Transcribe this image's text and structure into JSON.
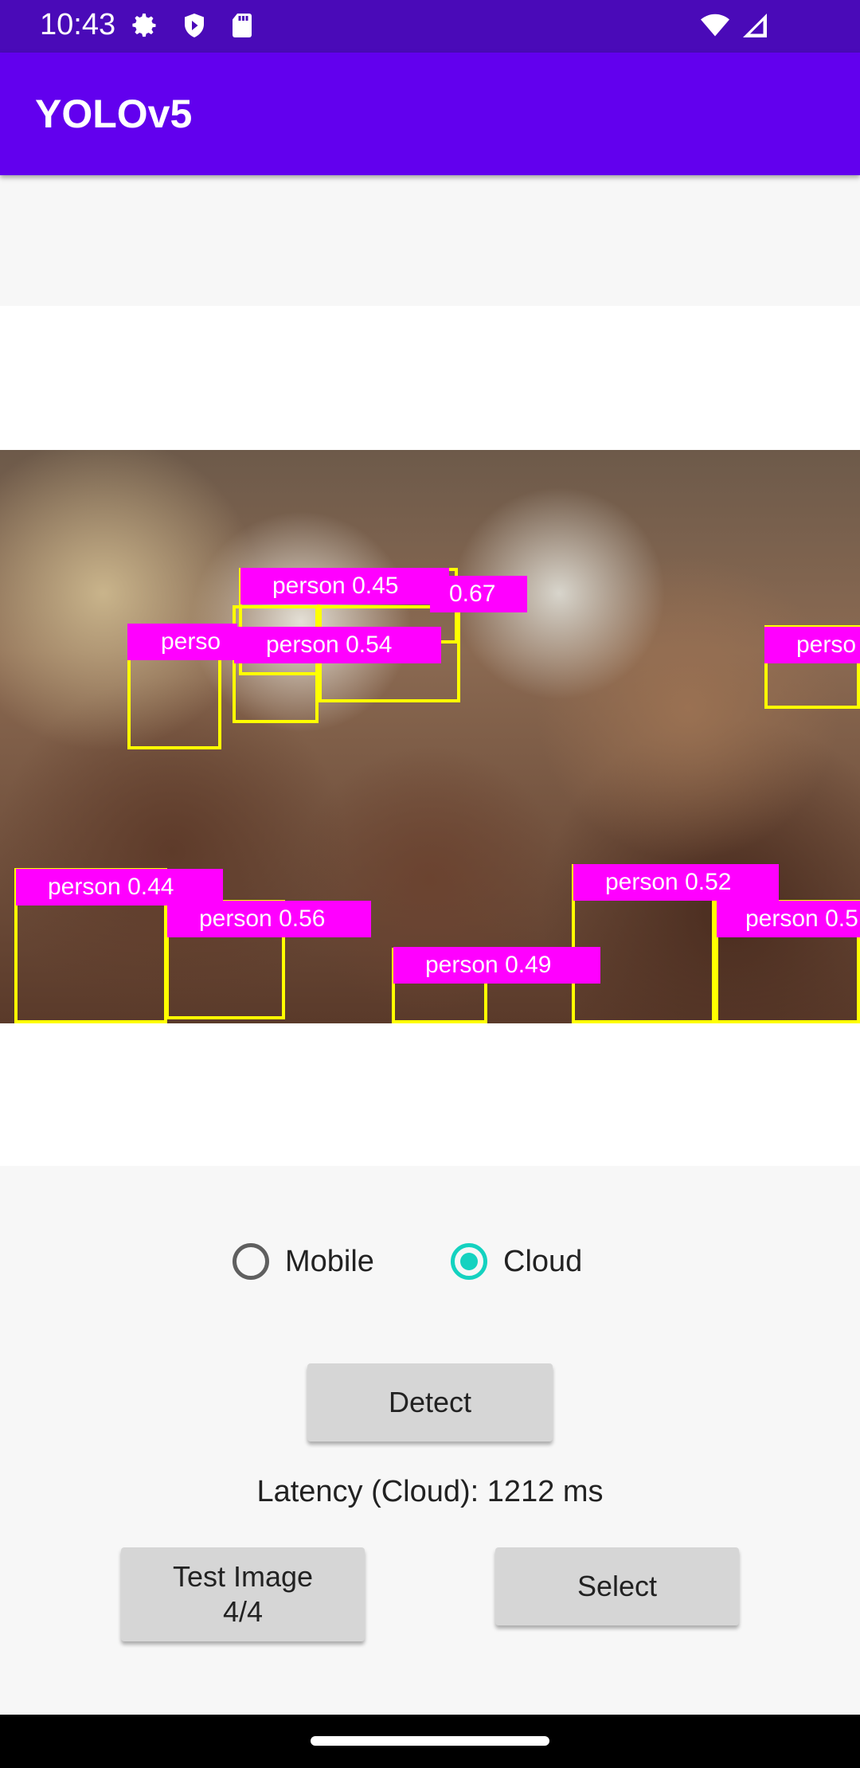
{
  "status_bar": {
    "time": "10:43",
    "icons": [
      "gear-icon",
      "shield-icon",
      "sd-card-icon",
      "wifi-icon",
      "signal-icon"
    ]
  },
  "app_bar": {
    "title": "YOLOv5"
  },
  "detections": [
    {
      "label": "person 0.45"
    },
    {
      "label": "0.67"
    },
    {
      "label": "perso"
    },
    {
      "label": "person 0.54"
    },
    {
      "label": "perso"
    },
    {
      "label": "person 0.44"
    },
    {
      "label": "person 0.56"
    },
    {
      "label": "person 0.49"
    },
    {
      "label": "person 0.52"
    },
    {
      "label": "person 0.5"
    }
  ],
  "mode": {
    "options": [
      {
        "label": "Mobile",
        "checked": false
      },
      {
        "label": "Cloud",
        "checked": true
      }
    ]
  },
  "actions": {
    "detect_label": "Detect",
    "latency_text": "Latency (Cloud): 1212 ms",
    "test_image_label_line1": "Test Image",
    "test_image_label_line2": "4/4",
    "select_label": "Select"
  },
  "colors": {
    "status_bar": "#4a0ab8",
    "app_bar": "#6200ee",
    "box_border": "#ffff00",
    "label_bg": "#ff00ff",
    "radio_checked": "#14d2c0"
  }
}
